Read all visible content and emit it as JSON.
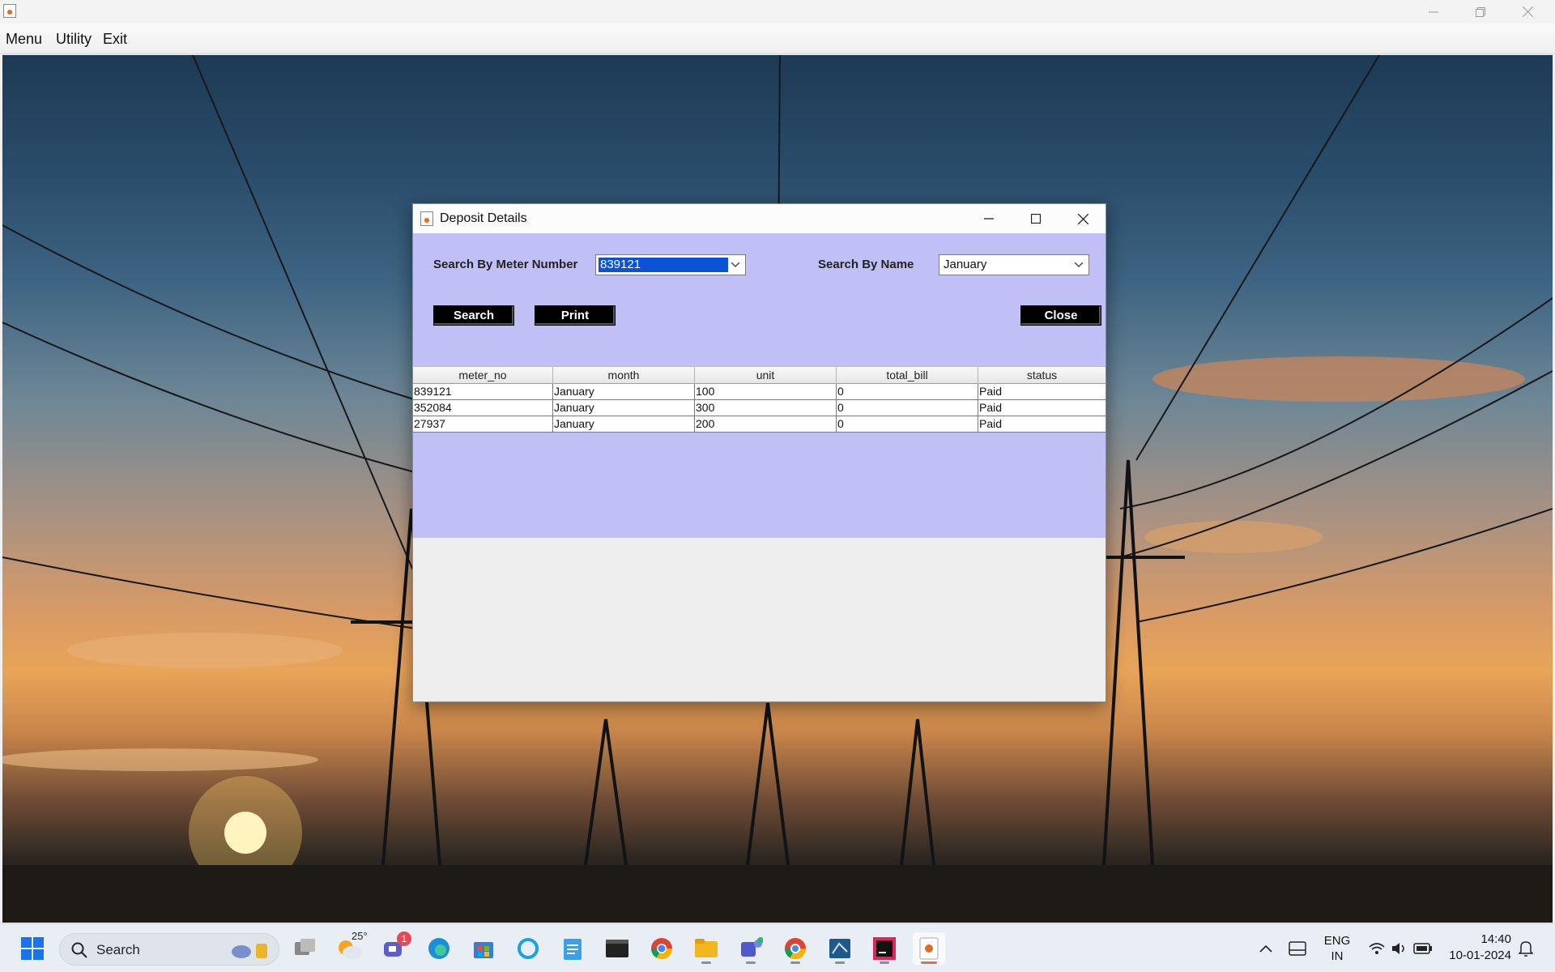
{
  "app": {
    "menu": [
      "Menu",
      "Utility",
      "Exit"
    ]
  },
  "dialog": {
    "title": "Deposit Details",
    "meter_label": "Search By Meter Number",
    "meter_value": "839121",
    "name_label": "Search By Name",
    "name_value": "January",
    "buttons": {
      "search": "Search",
      "print": "Print",
      "close": "Close"
    },
    "table": {
      "columns": [
        "meter_no",
        "month",
        "unit",
        "total_bill",
        "status"
      ],
      "rows": [
        [
          "839121",
          "January",
          "100",
          "0",
          "Paid"
        ],
        [
          "352084",
          "January",
          "300",
          "0",
          "Paid"
        ],
        [
          "27937",
          "January",
          "200",
          "0",
          "Paid"
        ]
      ]
    }
  },
  "taskbar": {
    "search_label": "Search",
    "weather_temp": "25°",
    "teams_badge": "1",
    "language_top": "ENG",
    "language_bottom": "IN",
    "time": "14:40",
    "date": "10-01-2024",
    "icons": [
      "windows-start-icon",
      "search-icon",
      "task-view-icon",
      "weather-icon",
      "teams-chat-icon",
      "edge-icon",
      "store-icon",
      "cortana-icon",
      "notepad-icon",
      "terminal-icon",
      "chrome-icon",
      "file-explorer-icon",
      "teams-icon",
      "chrome-dev-icon",
      "mysql-workbench-icon",
      "intellij-icon",
      "java-icon"
    ]
  },
  "colors": {
    "dialog_panel": "#c0c0f7",
    "button_bg": "#000000",
    "selection": "#0a52d6"
  }
}
